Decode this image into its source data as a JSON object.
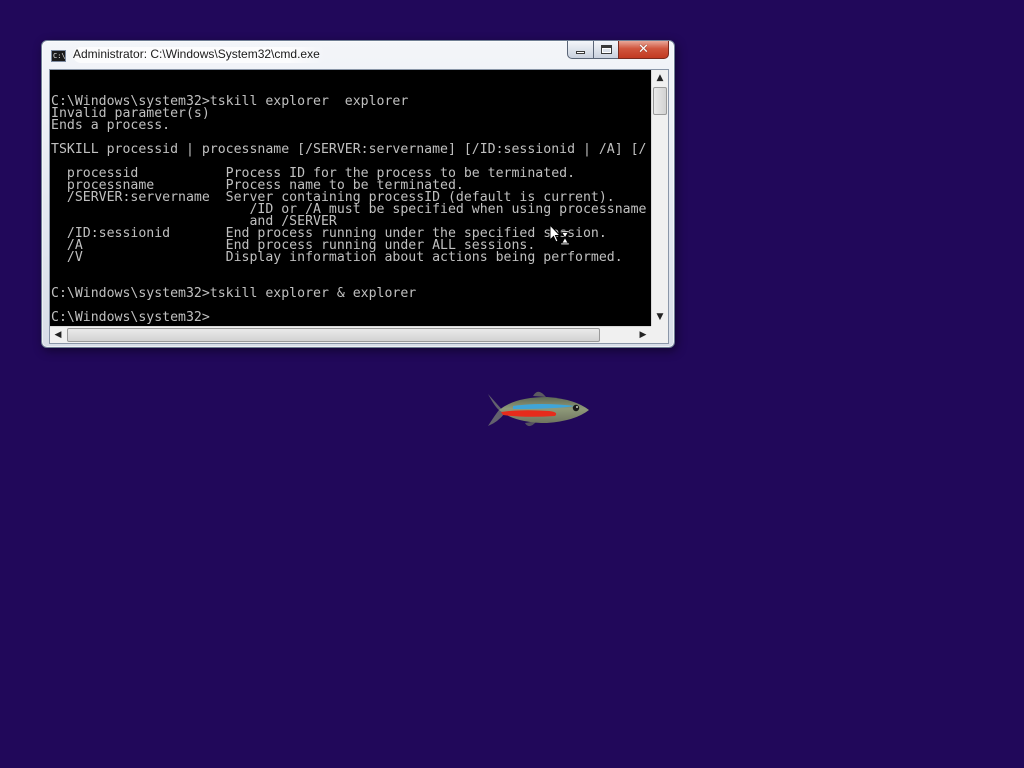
{
  "window": {
    "title": "Administrator: C:\\Windows\\System32\\cmd.exe",
    "icon": "cmd-icon",
    "icon_text": "C:\\",
    "close_glyph": "✕",
    "console_lines": [
      "C:\\Windows\\system32>tskill explorer  explorer",
      "Invalid parameter(s)",
      "Ends a process.",
      "",
      "TSKILL processid | processname [/SERVER:servername] [/ID:sessionid | /A] [/",
      "",
      "  processid           Process ID for the process to be terminated.",
      "  processname         Process name to be terminated.",
      "  /SERVER:servername  Server containing processID (default is current).",
      "                         /ID or /A must be specified when using processname",
      "                         and /SERVER",
      "  /ID:sessionid       End process running under the specified session.",
      "  /A                  End process running under ALL sessions.",
      "  /V                  Display information about actions being performed.",
      "",
      "",
      "C:\\Windows\\system32>tskill explorer & explorer",
      "",
      "C:\\Windows\\system32>"
    ],
    "scroll_up": "▲",
    "scroll_down": "▼",
    "scroll_left": "◀",
    "scroll_right": "▶"
  },
  "desktop": {
    "background_color": "#21085a"
  },
  "icons": [
    "cmd-icon",
    "minimize-icon",
    "maximize-icon",
    "close-icon",
    "busy-cursor-icon",
    "neon-tetra-fish-icon"
  ]
}
